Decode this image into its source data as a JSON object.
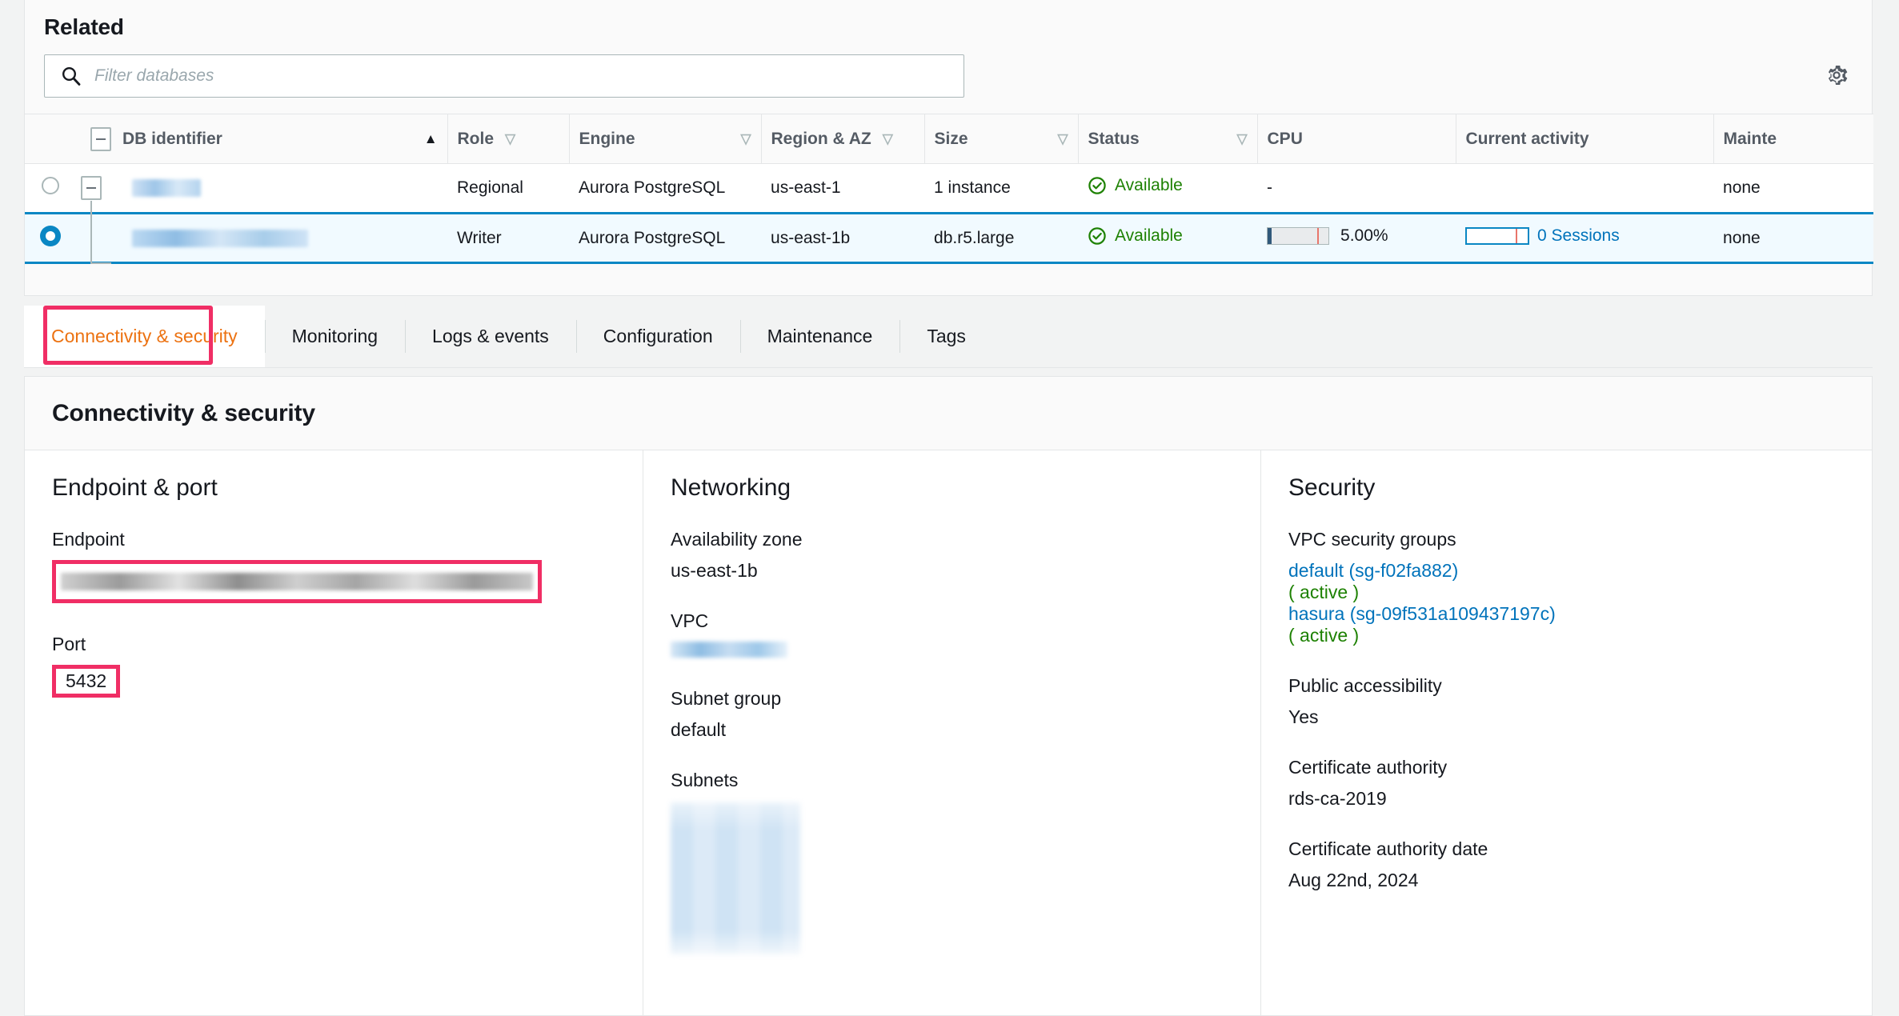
{
  "related": {
    "title": "Related",
    "search": {
      "placeholder": "Filter databases",
      "value": "",
      "icon": "search-icon"
    },
    "settings_icon": "gear-icon",
    "columns": [
      {
        "label": "DB identifier",
        "sort": "asc"
      },
      {
        "label": "Role",
        "sort": "none"
      },
      {
        "label": "Engine",
        "sort": "none"
      },
      {
        "label": "Region & AZ",
        "sort": "none"
      },
      {
        "label": "Size",
        "sort": "none"
      },
      {
        "label": "Status",
        "sort": "none"
      },
      {
        "label": "CPU",
        "sort": null
      },
      {
        "label": "Current activity",
        "sort": null
      },
      {
        "label": "Mainte",
        "sort": null
      }
    ],
    "rows": [
      {
        "selected": false,
        "db_identifier": "",
        "role": "Regional",
        "engine": "Aurora PostgreSQL",
        "region_az": "us-east-1",
        "size": "1 instance",
        "status": "Available",
        "cpu": "-",
        "cpu_percent": null,
        "current_activity": "",
        "maintenance": "none"
      },
      {
        "selected": true,
        "db_identifier": "",
        "role": "Writer",
        "engine": "Aurora PostgreSQL",
        "region_az": "us-east-1b",
        "size": "db.r5.large",
        "status": "Available",
        "cpu": "5.00%",
        "cpu_percent": 5,
        "current_activity": "0 Sessions",
        "maintenance": "none"
      }
    ]
  },
  "tabs": [
    {
      "label": "Connectivity & security",
      "active": true
    },
    {
      "label": "Monitoring",
      "active": false
    },
    {
      "label": "Logs & events",
      "active": false
    },
    {
      "label": "Configuration",
      "active": false
    },
    {
      "label": "Maintenance",
      "active": false
    },
    {
      "label": "Tags",
      "active": false
    }
  ],
  "connectivity": {
    "panel_title": "Connectivity & security",
    "endpoint_port": {
      "heading": "Endpoint & port",
      "endpoint_label": "Endpoint",
      "endpoint_value": "",
      "port_label": "Port",
      "port_value": "5432"
    },
    "networking": {
      "heading": "Networking",
      "az_label": "Availability zone",
      "az_value": "us-east-1b",
      "vpc_label": "VPC",
      "vpc_value": "",
      "subnet_group_label": "Subnet group",
      "subnet_group_value": "default",
      "subnets_label": "Subnets",
      "subnets_value": ""
    },
    "security": {
      "heading": "Security",
      "vpc_sg_label": "VPC security groups",
      "groups": [
        {
          "name": "default (sg-f02fa882)",
          "state": "( active )"
        },
        {
          "name": "hasura (sg-09f531a109437197c)",
          "state": "( active )"
        }
      ],
      "public_label": "Public accessibility",
      "public_value": "Yes",
      "ca_label": "Certificate authority",
      "ca_value": "rds-ca-2019",
      "ca_date_label": "Certificate authority date",
      "ca_date_value": "Aug 22nd, 2024"
    }
  },
  "colors": {
    "annotation": "#f02e65",
    "active_tab": "#ec7211",
    "link": "#0073bb",
    "status_green": "#1d8102",
    "selection_border": "#0a87c4"
  }
}
